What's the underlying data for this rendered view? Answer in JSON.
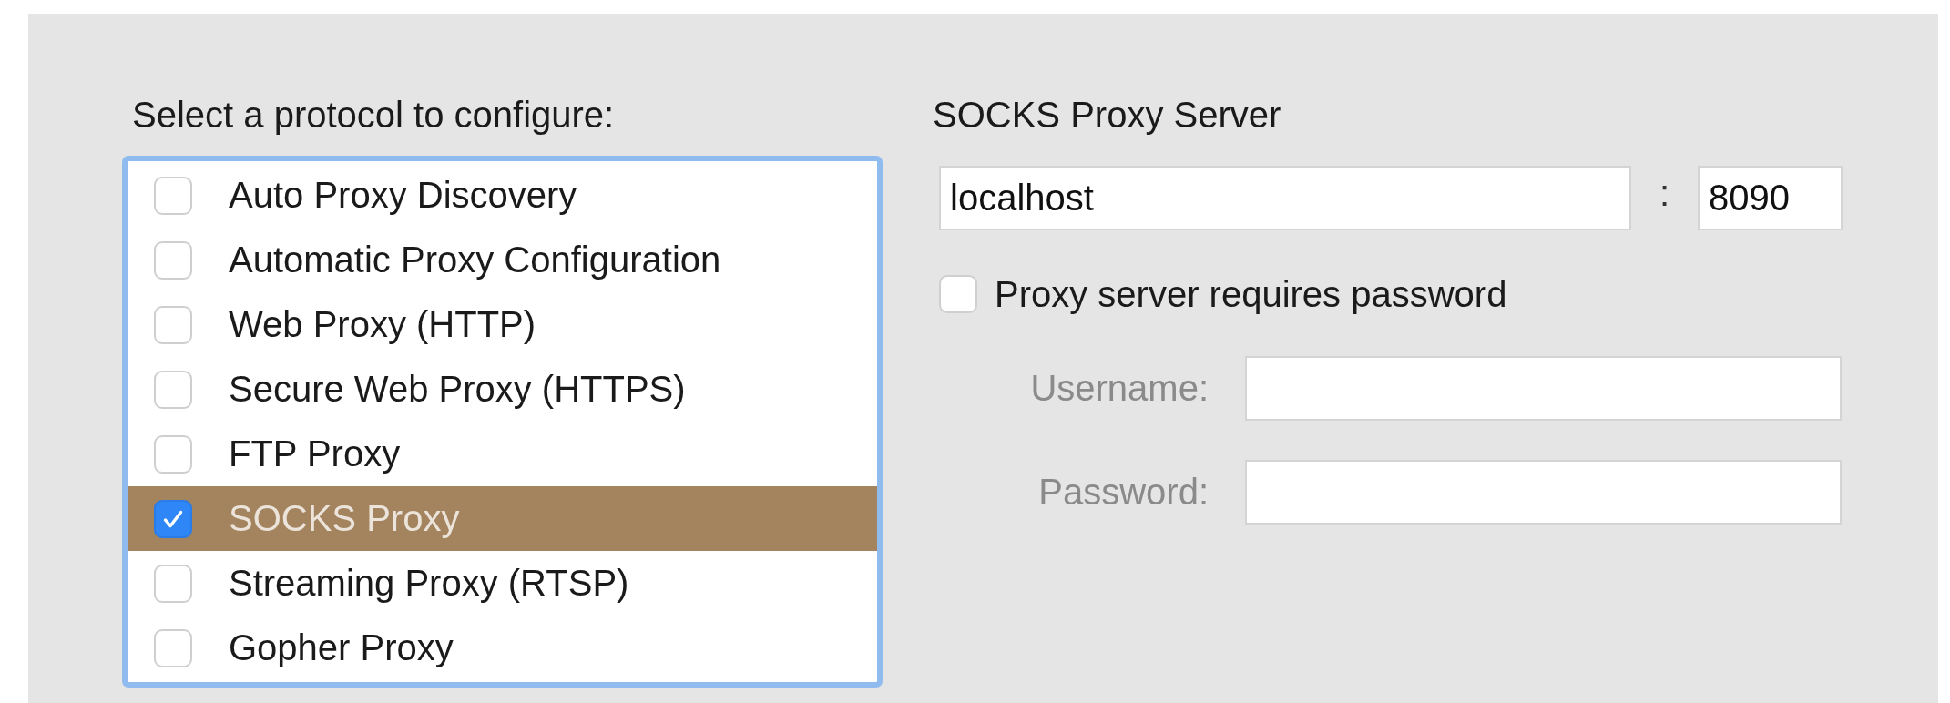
{
  "protocols": {
    "heading": "Select a protocol to configure:",
    "items": [
      {
        "label": "Auto Proxy Discovery",
        "checked": false,
        "selected": false
      },
      {
        "label": "Automatic Proxy Configuration",
        "checked": false,
        "selected": false
      },
      {
        "label": "Web Proxy (HTTP)",
        "checked": false,
        "selected": false
      },
      {
        "label": "Secure Web Proxy (HTTPS)",
        "checked": false,
        "selected": false
      },
      {
        "label": "FTP Proxy",
        "checked": false,
        "selected": false
      },
      {
        "label": "SOCKS Proxy",
        "checked": true,
        "selected": true
      },
      {
        "label": "Streaming Proxy (RTSP)",
        "checked": false,
        "selected": false
      },
      {
        "label": "Gopher Proxy",
        "checked": false,
        "selected": false
      }
    ]
  },
  "server": {
    "heading": "SOCKS Proxy Server",
    "host": "localhost",
    "separator": ":",
    "port": "8090",
    "requires_password": {
      "label": "Proxy server requires password",
      "checked": false
    },
    "credentials": [
      {
        "label": "Username:",
        "disabled": true
      },
      {
        "label": "Password:",
        "disabled": true
      }
    ]
  }
}
